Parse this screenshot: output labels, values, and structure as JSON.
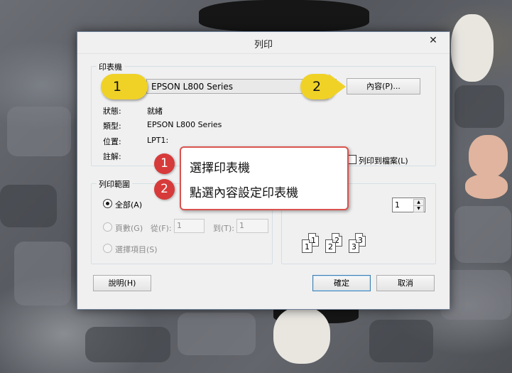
{
  "dialog": {
    "title": "列印",
    "close_symbol": "✕"
  },
  "printer_group": {
    "title": "印表機",
    "selected_printer": "EPSON L800 Series",
    "properties_button": "內容(P)...",
    "rows": [
      {
        "label": "狀態:",
        "value": "就緒"
      },
      {
        "label": "類型:",
        "value": "EPSON L800 Series"
      },
      {
        "label": "位置:",
        "value": "LPT1:"
      },
      {
        "label": "註解:",
        "value": ""
      }
    ],
    "print_to_file_label": "列印到檔案(L)"
  },
  "range_group": {
    "title": "列印範圍",
    "all_label": "全部(A)",
    "pages_label": "頁數(G)",
    "from_label": "從(F):",
    "from_value": "1",
    "to_label": "到(T):",
    "to_value": "1",
    "selection_label": "選擇項目(S)"
  },
  "copies": {
    "count": "1",
    "collate_pages": [
      "1",
      "1",
      "2",
      "2",
      "3",
      "3"
    ]
  },
  "buttons": {
    "help": "說明(H)",
    "ok": "確定",
    "cancel": "取消"
  },
  "annotations": {
    "tag1": "1",
    "tag2": "2",
    "callout_num1": "1",
    "callout_num2": "2",
    "step1": "選擇印表機",
    "step2": "點選內容設定印表機"
  },
  "colors": {
    "tag_yellow": "#f0d227",
    "callout_red": "#d9534f",
    "dialog_bg": "#f0f0f0"
  }
}
